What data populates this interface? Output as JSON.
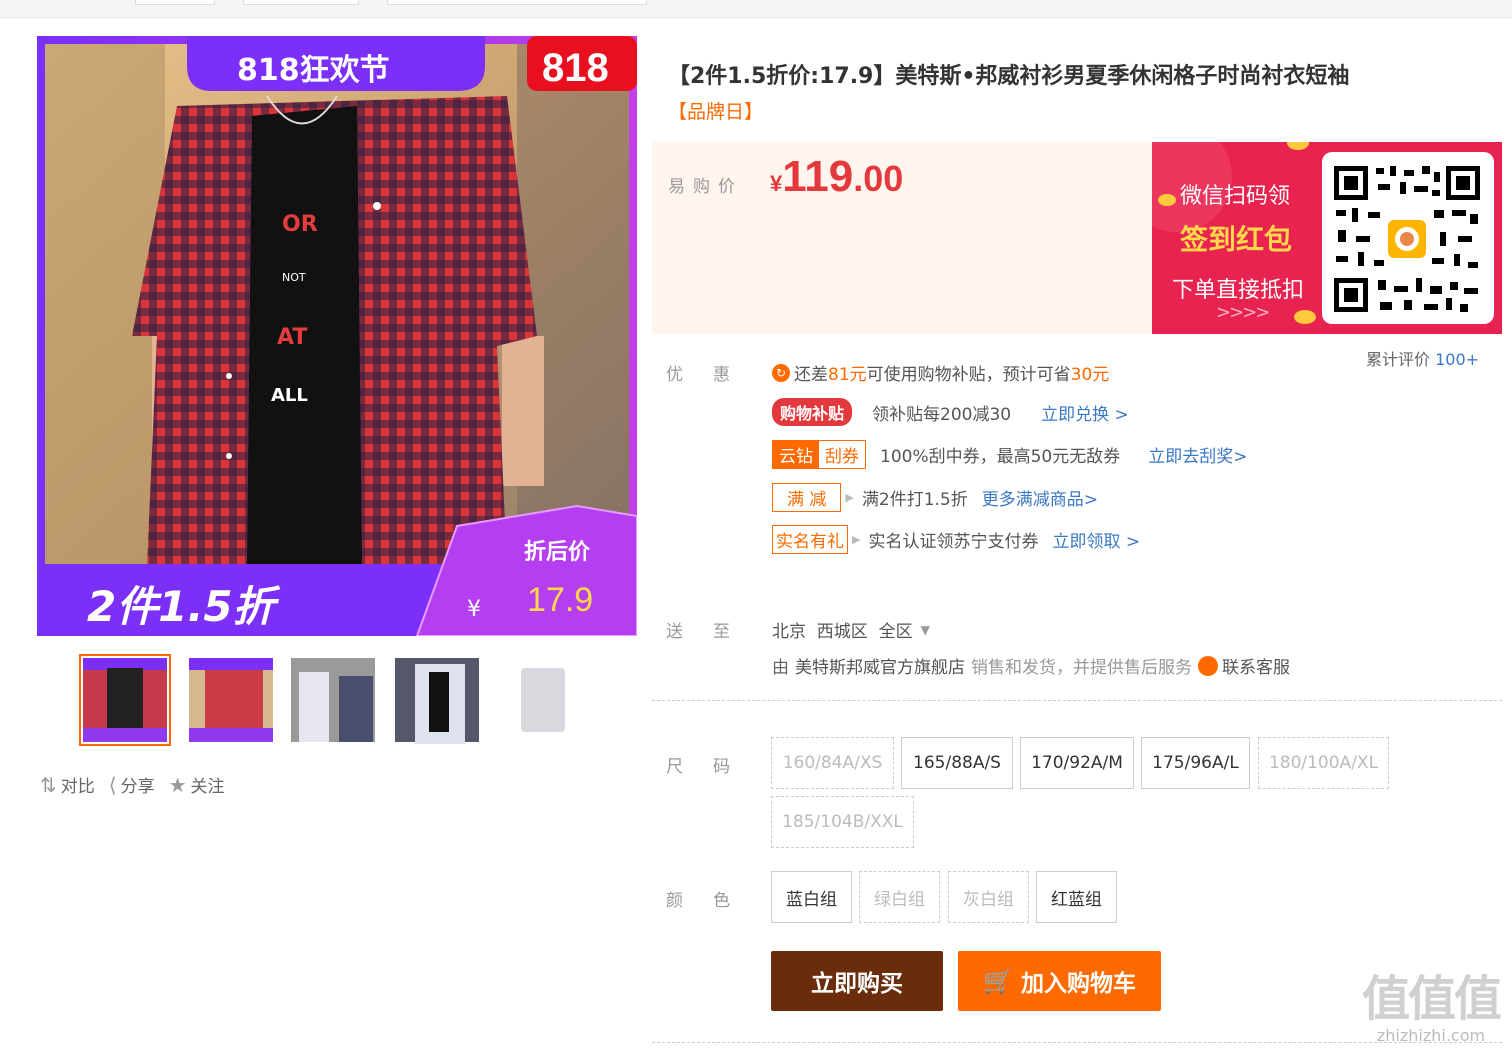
{
  "gallery": {
    "banner_text": "818狂欢节",
    "badge_text": "818",
    "shirt_text": [
      "OR",
      "NOT",
      "AT",
      "ALL"
    ],
    "promo_text": "2件1.5折",
    "after_discount_label": "折后价",
    "after_discount_currency": "¥",
    "after_discount_price": "17.9",
    "thumbnails": [
      {
        "name": "thumb-1",
        "active": true
      },
      {
        "name": "thumb-2",
        "active": false
      },
      {
        "name": "thumb-3",
        "active": false
      },
      {
        "name": "thumb-4",
        "active": false
      },
      {
        "name": "thumb-5",
        "active": false
      }
    ],
    "actions": [
      {
        "icon": "compare-icon",
        "label": "对比"
      },
      {
        "icon": "share-icon",
        "label": "分享"
      },
      {
        "icon": "star-icon",
        "label": "关注"
      }
    ]
  },
  "product": {
    "title": "【2件1.5折价:17.9】美特斯•邦威衬衫男夏季休闲格子时尚衬衣短袖",
    "brand_day": "【品牌日】"
  },
  "price": {
    "label": "易购价",
    "currency": "¥",
    "integer": "119",
    "decimal": ".00"
  },
  "promo_banner": {
    "line1": "微信扫码领",
    "line2": "签到红包",
    "line3": "下单直接抵扣",
    "arrows": ">>>>"
  },
  "review": {
    "label": "累计评价",
    "count": "100+"
  },
  "discount": {
    "label": "优惠",
    "subsidy": {
      "prefix": "还差",
      "amount": "81元",
      "middle": "可使用购物补贴，预计可省",
      "save": "30元"
    },
    "rows": [
      {
        "tag": "购物补贴",
        "text": "领补贴每200减30",
        "link": "立即兑换 >"
      },
      {
        "tag_a": "云钻",
        "tag_b": "刮券",
        "text": "100%刮中券，最高50元无敌券",
        "link": "立即去刮奖>"
      },
      {
        "tag": "满 减",
        "text": "满2件打1.5折",
        "link": "更多满减商品>"
      },
      {
        "tag": "实名有礼",
        "text": "实名认证领苏宁支付券",
        "link": "立即领取 >"
      }
    ]
  },
  "delivery": {
    "label": "送至",
    "location": "北京  西城区  全区",
    "seller_prefix": "由",
    "seller": "美特斯邦威官方旗舰店",
    "seller_suffix": "销售和发货，并提供售后服务",
    "contact": "联系客服"
  },
  "size": {
    "label": "尺码",
    "options": [
      {
        "label": "160/84A/XS",
        "available": false
      },
      {
        "label": "165/88A/S",
        "available": true
      },
      {
        "label": "170/92A/M",
        "available": true
      },
      {
        "label": "175/96A/L",
        "available": true
      },
      {
        "label": "180/100A/XL",
        "available": false
      },
      {
        "label": "185/104B/XXL",
        "available": false
      }
    ]
  },
  "color": {
    "label": "颜色",
    "options": [
      {
        "label": "蓝白组",
        "available": true
      },
      {
        "label": "绿白组",
        "available": false
      },
      {
        "label": "灰白组",
        "available": false
      },
      {
        "label": "红蓝组",
        "available": true
      }
    ]
  },
  "buttons": {
    "buy_now": "立即购买",
    "add_to_cart": "加入购物车"
  },
  "watermark": {
    "big": "值值值",
    "small": "zhizhizhi.com"
  },
  "colors": {
    "accent_orange": "#ff6a00",
    "price_red": "#e4393c",
    "buy_brown": "#6a2c0b",
    "link_blue": "#3a78c4"
  }
}
